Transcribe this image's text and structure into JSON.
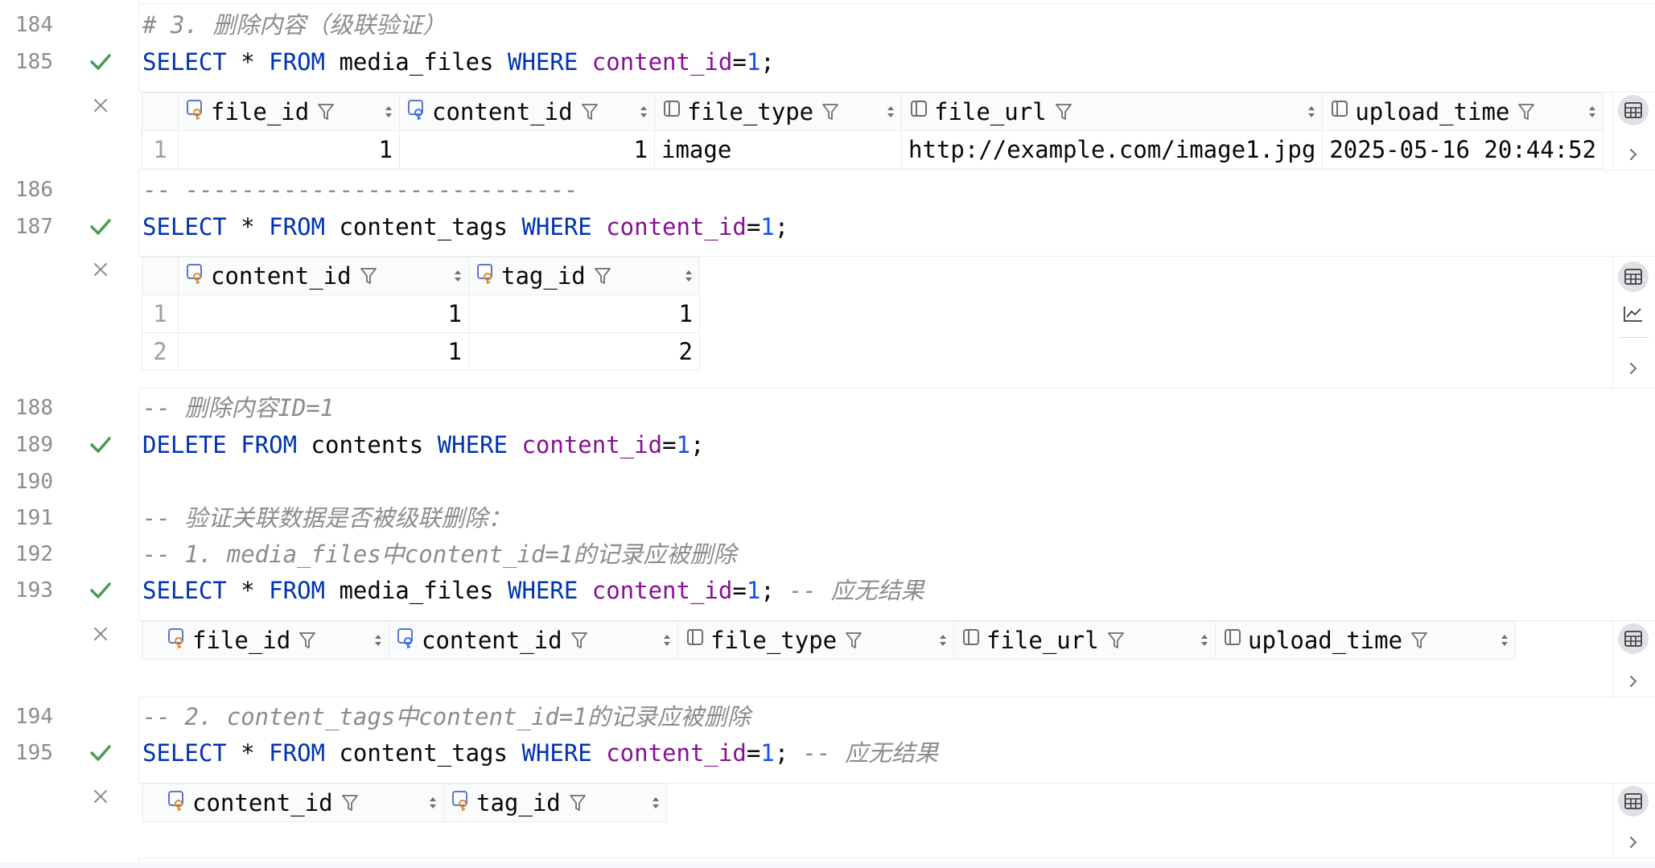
{
  "editor": {
    "lines": [
      {
        "num": "184",
        "text": "# 3. 删除内容（级联验证）"
      },
      {
        "num": "185",
        "kw1": "SELECT",
        "op": " * ",
        "kw2": "FROM",
        "table": " media_files ",
        "kw3": "WHERE",
        "field": " content_id",
        "eq": "=",
        "val": "1",
        "end": ";"
      },
      {
        "num": "186",
        "text": "-- ----------------------------"
      },
      {
        "num": "187",
        "kw1": "SELECT",
        "op": " * ",
        "kw2": "FROM",
        "table": " content_tags ",
        "kw3": "WHERE",
        "field": " content_id",
        "eq": "=",
        "val": "1",
        "end": ";"
      },
      {
        "num": "188",
        "text": "-- 删除内容ID=1"
      },
      {
        "num": "189",
        "kw1": "DELETE",
        "kw2": " FROM",
        "table": " contents ",
        "kw3": "WHERE",
        "field": " content_id",
        "eq": "=",
        "val": "1",
        "end": ";"
      },
      {
        "num": "190"
      },
      {
        "num": "191",
        "text": "-- 验证关联数据是否被级联删除："
      },
      {
        "num": "192",
        "text": "-- 1. media_files中content_id=1的记录应被删除"
      },
      {
        "num": "193",
        "kw1": "SELECT",
        "op": " * ",
        "kw2": "FROM",
        "table": " media_files ",
        "kw3": "WHERE",
        "field": " content_id",
        "eq": "=",
        "val": "1",
        "end": "; ",
        "comment": "-- 应无结果"
      },
      {
        "num": "194",
        "text": "-- 2. content_tags中content_id=1的记录应被删除"
      },
      {
        "num": "195",
        "kw1": "SELECT",
        "op": " * ",
        "kw2": "FROM",
        "table": " content_tags ",
        "kw3": "WHERE",
        "field": " content_id",
        "eq": "=",
        "val": "1",
        "end": "; ",
        "comment": "-- 应无结果"
      }
    ]
  },
  "results": [
    {
      "columns": [
        "file_id",
        "content_id",
        "file_type",
        "file_url",
        "upload_time"
      ],
      "rows": [
        {
          "n": "1",
          "cells": [
            "1",
            "1",
            "image",
            "http://example.com/image1.jpg",
            "2025-05-16 20:44:52"
          ]
        }
      ]
    },
    {
      "columns": [
        "content_id",
        "tag_id"
      ],
      "rows": [
        {
          "n": "1",
          "cells": [
            "1",
            "1"
          ]
        },
        {
          "n": "2",
          "cells": [
            "1",
            "2"
          ]
        }
      ]
    },
    {
      "columns": [
        "file_id",
        "content_id",
        "file_type",
        "file_url",
        "upload_time"
      ],
      "rows": []
    },
    {
      "columns": [
        "content_id",
        "tag_id"
      ],
      "rows": []
    }
  ],
  "icons": {
    "executed": "check-icon",
    "close": "close-icon",
    "key_column": "key-column-icon",
    "column": "column-icon",
    "filter": "filter-icon",
    "sort": "sort-icon",
    "table_view": "table-view-icon",
    "chart_view": "chart-icon",
    "expand": "chevron-right-icon"
  },
  "colors": {
    "keyword": "#0033b3",
    "field": "#871094",
    "number": "#1750eb",
    "comment": "#8c8c8c",
    "success": "#499c54"
  }
}
